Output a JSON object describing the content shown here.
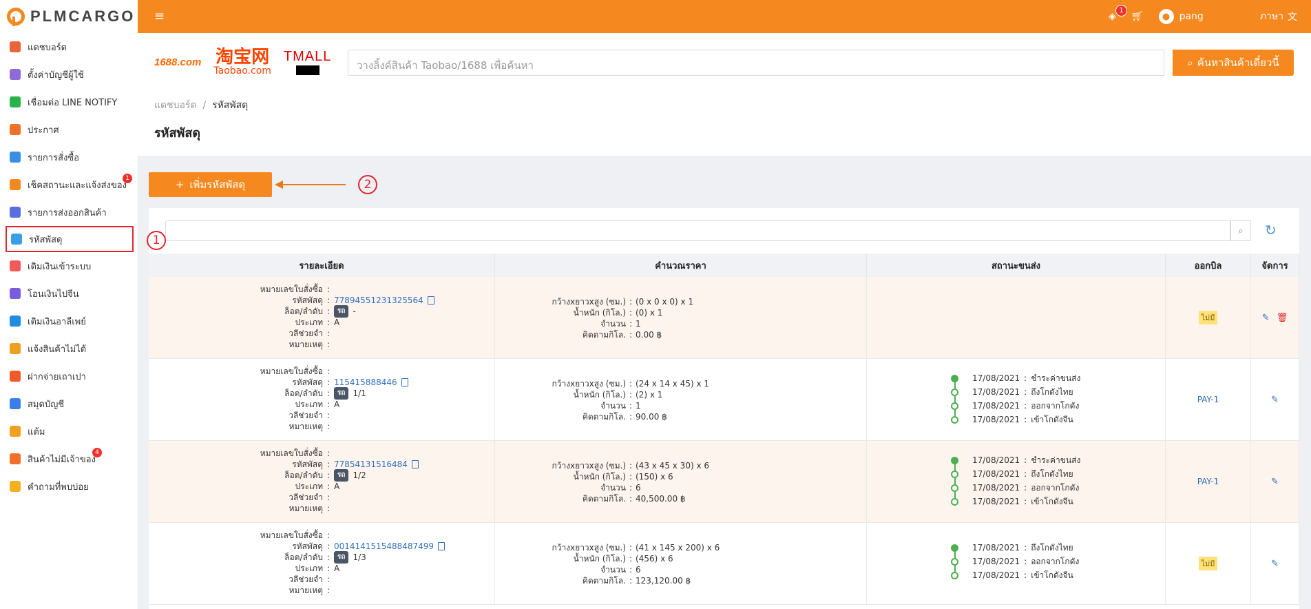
{
  "brand": {
    "name": "PLMCARGO"
  },
  "colors": {
    "accent": "#f5891f",
    "link": "#2f6fbd",
    "danger": "#e0262d",
    "success": "#4caf50"
  },
  "sidebar": {
    "items": [
      {
        "label": "แดชบอร์ด",
        "icon": "chart-icon",
        "color": "#e8643a"
      },
      {
        "label": "ตั้งค่าบัญชีผู้ใช้",
        "icon": "user-settings-icon",
        "color": "#8e6bd8"
      },
      {
        "label": "เชื่อมต่อ LINE NOTIFY",
        "icon": "line-icon",
        "color": "#2bb34b"
      },
      {
        "label": "ประกาศ",
        "icon": "megaphone-icon",
        "color": "#f0702a"
      },
      {
        "label": "รายการสั่งซื้อ",
        "icon": "cart-box-icon",
        "color": "#3a8ee6"
      },
      {
        "label": "เช็คสถานะและแจ้งส่งของ",
        "icon": "truck-icon",
        "color": "#f5891f",
        "badge": "1"
      },
      {
        "label": "รายการส่งออกสินค้า",
        "icon": "dolly-icon",
        "color": "#5b6ee0"
      },
      {
        "label": "รหัสพัสดุ",
        "icon": "package-icon",
        "color": "#3aa0e6",
        "active": true
      },
      {
        "label": "เติมเงินเข้าระบบ",
        "icon": "piggy-bank-icon",
        "color": "#f05a5a"
      },
      {
        "label": "โอนเงินไปจีน",
        "icon": "yuan-icon",
        "color": "#7b5be0"
      },
      {
        "label": "เติมเงินอาลีเพย์",
        "icon": "alipay-icon",
        "color": "#1f8de0"
      },
      {
        "label": "แจ้งสินค้าไม่ได้",
        "icon": "missing-item-icon",
        "color": "#f0a020"
      },
      {
        "label": "ฝากจ่ายเถาเปา",
        "icon": "taobao-pay-icon",
        "color": "#f05a2a"
      },
      {
        "label": "สมุดบัญชี",
        "icon": "wallet-icon",
        "color": "#3a7ee6"
      },
      {
        "label": "แต้ม",
        "icon": "coin-bag-icon",
        "color": "#f0a020"
      },
      {
        "label": "สินค้าไม่มีเจ้าของ",
        "icon": "unclaimed-icon",
        "color": "#f0702a",
        "badge": "4"
      },
      {
        "label": "คำถามที่พบบ่อย",
        "icon": "question-icon",
        "color": "#f5b01f"
      }
    ]
  },
  "topbar": {
    "menu_icon": "≡",
    "layers_badge": "1",
    "user_name": "pang",
    "language_label": "ภาษา"
  },
  "header": {
    "brands": [
      "1688.com",
      "淘宝网",
      "Taobao.com",
      "TMALL"
    ],
    "search_placeholder": "วางลิ้งค์สินค้า Taobao/1688 เพื่อค้นหา",
    "search_button": "ค้นหาสินค้าเดี๋ยวนี้",
    "breadcrumb": {
      "home": "แดชบอร์ด",
      "sep": "/",
      "current": "รหัสพัสดุ"
    },
    "page_title": "รหัสพัสดุ"
  },
  "add_button": "เพิ่มรหัสพัสดุ",
  "annotations": {
    "one": "1",
    "two": "2"
  },
  "table": {
    "columns": [
      "รายละเอียด",
      "คำนวณราคา",
      "สถานะขนส่ง",
      "ออกบิล",
      "จัดการ"
    ],
    "detail_labels": [
      "หมายเลขใบสั่งซื้อ",
      "รหัสพัสดุ",
      "ล็อต/ลำดับ",
      "ประเภท",
      "วลีช่วยจำ",
      "หมายเหตุ"
    ],
    "calc_labels": [
      "กว้างxยาวxสูง (ซม.)",
      "น้ำหนัก (กิโล.)",
      "จำนวน",
      "คิดตามกิโล."
    ],
    "lot_tag": "รถ",
    "rows": [
      {
        "highlight": true,
        "tracking": "77894551231325564",
        "lot": "-",
        "type": "A",
        "dims": "(0 x 0 x 0) x 1",
        "weight": "(0) x 1",
        "qty": "1",
        "price": "0.00 ฿",
        "timeline": [],
        "bill": "ไม่มี",
        "bill_type": "none",
        "deletable": true
      },
      {
        "highlight": false,
        "tracking": "115415888446",
        "lot": "1/1",
        "type": "A",
        "dims": "(24 x 14 x 45) x 1",
        "weight": "(2) x 1",
        "qty": "1",
        "price": "90.00 ฿",
        "timeline": [
          {
            "date": "17/08/2021",
            "status": "ชำระค่าขนส่ง"
          },
          {
            "date": "17/08/2021",
            "status": "ถึงโกดังไทย"
          },
          {
            "date": "17/08/2021",
            "status": "ออกจากโกดัง"
          },
          {
            "date": "17/08/2021",
            "status": "เข้าโกดังจีน"
          }
        ],
        "bill": "PAY-1",
        "bill_type": "link",
        "deletable": false
      },
      {
        "highlight": true,
        "tracking": "77854131516484",
        "lot": "1/2",
        "type": "A",
        "dims": "(43 x 45 x 30) x 6",
        "weight": "(150) x 6",
        "qty": "6",
        "price": "40,500.00 ฿",
        "timeline": [
          {
            "date": "17/08/2021",
            "status": "ชำระค่าขนส่ง"
          },
          {
            "date": "17/08/2021",
            "status": "ถึงโกดังไทย"
          },
          {
            "date": "17/08/2021",
            "status": "ออกจากโกดัง"
          },
          {
            "date": "17/08/2021",
            "status": "เข้าโกดังจีน"
          }
        ],
        "bill": "PAY-1",
        "bill_type": "link",
        "deletable": false
      },
      {
        "highlight": false,
        "tracking": "0014141515488487499",
        "lot": "1/3",
        "type": "A",
        "dims": "(41 x 145 x 200) x 6",
        "weight": "(456) x 6",
        "qty": "6",
        "price": "123,120.00 ฿",
        "timeline": [
          {
            "date": "17/08/2021",
            "status": "ถึงโกดังไทย"
          },
          {
            "date": "17/08/2021",
            "status": "ออกจากโกดัง"
          },
          {
            "date": "17/08/2021",
            "status": "เข้าโกดังจีน"
          }
        ],
        "bill": "ไม่มี",
        "bill_type": "none",
        "deletable": false
      }
    ]
  }
}
